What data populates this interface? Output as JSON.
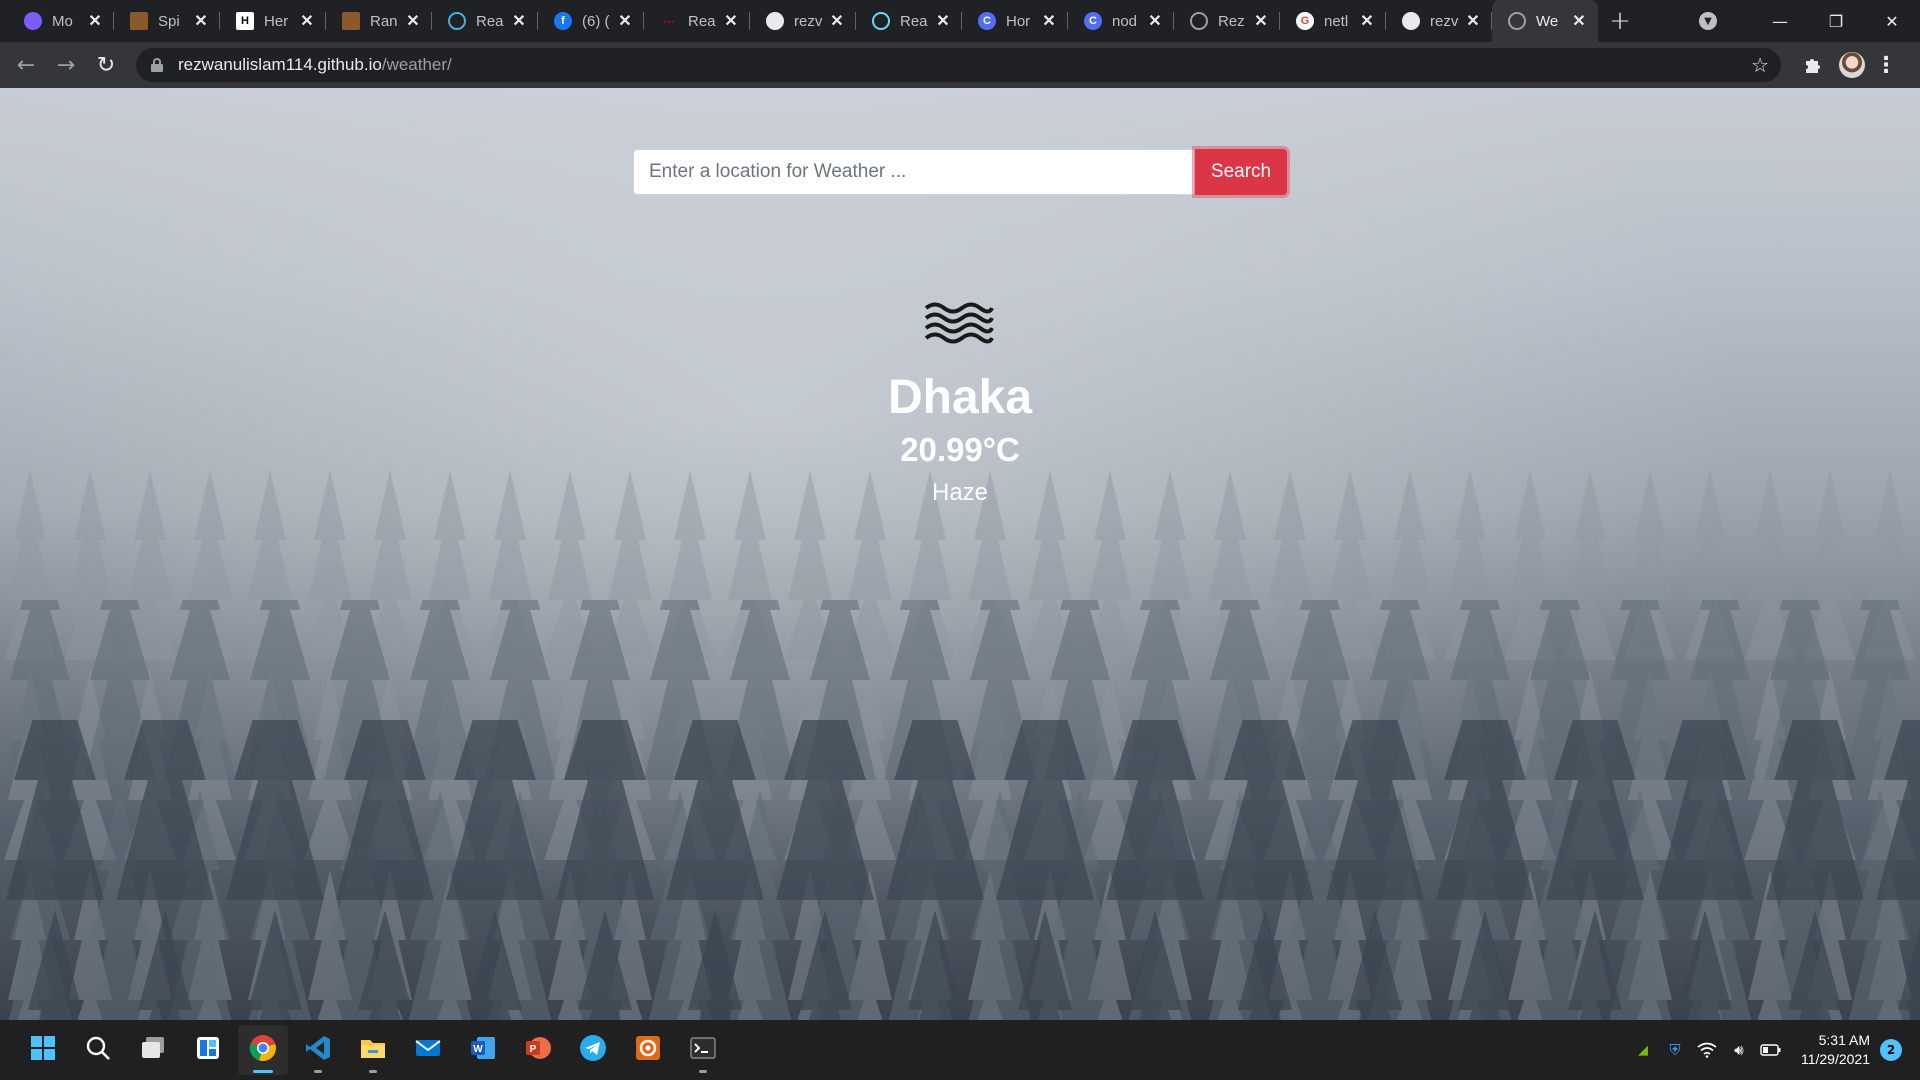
{
  "browser": {
    "tabs": [
      {
        "title": "Mo",
        "favicon": "mongodb-leaf-icon",
        "color": "#7c5cff",
        "active": false
      },
      {
        "title": "Spi",
        "favicon": "bookmark-doc-icon",
        "color": "#8a5a2b",
        "active": false
      },
      {
        "title": "Her",
        "favicon": "hero-h-icon",
        "color": "#ffffff",
        "active": false
      },
      {
        "title": "Ran",
        "favicon": "bookmark-doc-icon",
        "color": "#8a5a2b",
        "active": false
      },
      {
        "title": "Rea",
        "favicon": "react-bootstrap-icon",
        "color": "#41b0e8",
        "active": false
      },
      {
        "title": "(6) (",
        "favicon": "facebook-icon",
        "color": "#1877f2",
        "active": false
      },
      {
        "title": "Rea",
        "favicon": "react-router-icon",
        "color": "#d0021b",
        "active": false
      },
      {
        "title": "rezv",
        "favicon": "github-icon",
        "color": "#e8eaed",
        "active": false
      },
      {
        "title": "Rea",
        "favicon": "react-icon",
        "color": "#61dafb",
        "active": false
      },
      {
        "title": "Hor",
        "favicon": "c-logo-icon",
        "color": "#4f6df5",
        "active": false
      },
      {
        "title": "nod",
        "favicon": "c-logo-icon",
        "color": "#4f6df5",
        "active": false
      },
      {
        "title": "Rez",
        "favicon": "globe-icon",
        "color": "#9aa0a6",
        "active": false
      },
      {
        "title": "netl",
        "favicon": "google-icon",
        "color": "#ea4335",
        "active": false
      },
      {
        "title": "rezv",
        "favicon": "github-icon",
        "color": "#e8eaed",
        "active": false
      },
      {
        "title": "We",
        "favicon": "globe-icon",
        "color": "#9aa0a6",
        "active": true
      }
    ],
    "url_host": "rezwanulislam114.github.io",
    "url_path": "/weather/"
  },
  "page": {
    "search_placeholder": "Enter a location for Weather ...",
    "search_value": "",
    "search_button": "Search",
    "weather_icon": "haze-waves-icon",
    "city": "Dhaka",
    "temperature": "20.99°C",
    "condition": "Haze"
  },
  "taskbar": {
    "apps": [
      {
        "name": "windows-start-icon",
        "active": false,
        "running": false
      },
      {
        "name": "search-icon",
        "active": false,
        "running": false
      },
      {
        "name": "task-view-icon",
        "active": false,
        "running": false
      },
      {
        "name": "widgets-icon",
        "active": false,
        "running": false
      },
      {
        "name": "chrome-icon",
        "active": true,
        "running": true
      },
      {
        "name": "vscode-icon",
        "active": false,
        "running": true
      },
      {
        "name": "file-explorer-icon",
        "active": false,
        "running": true
      },
      {
        "name": "mail-icon",
        "active": false,
        "running": false
      },
      {
        "name": "word-icon",
        "active": false,
        "running": false
      },
      {
        "name": "powerpoint-icon",
        "active": false,
        "running": false
      },
      {
        "name": "telegram-icon",
        "active": false,
        "running": false
      },
      {
        "name": "sublime-merge-icon",
        "active": false,
        "running": false
      },
      {
        "name": "terminal-icon",
        "active": false,
        "running": true
      }
    ],
    "time": "5:31 AM",
    "date": "11/29/2021",
    "notifications": "2"
  },
  "colors": {
    "accent_danger": "#dc3545",
    "taskbar_bg": "#202020",
    "chrome_dark": "#202124"
  }
}
